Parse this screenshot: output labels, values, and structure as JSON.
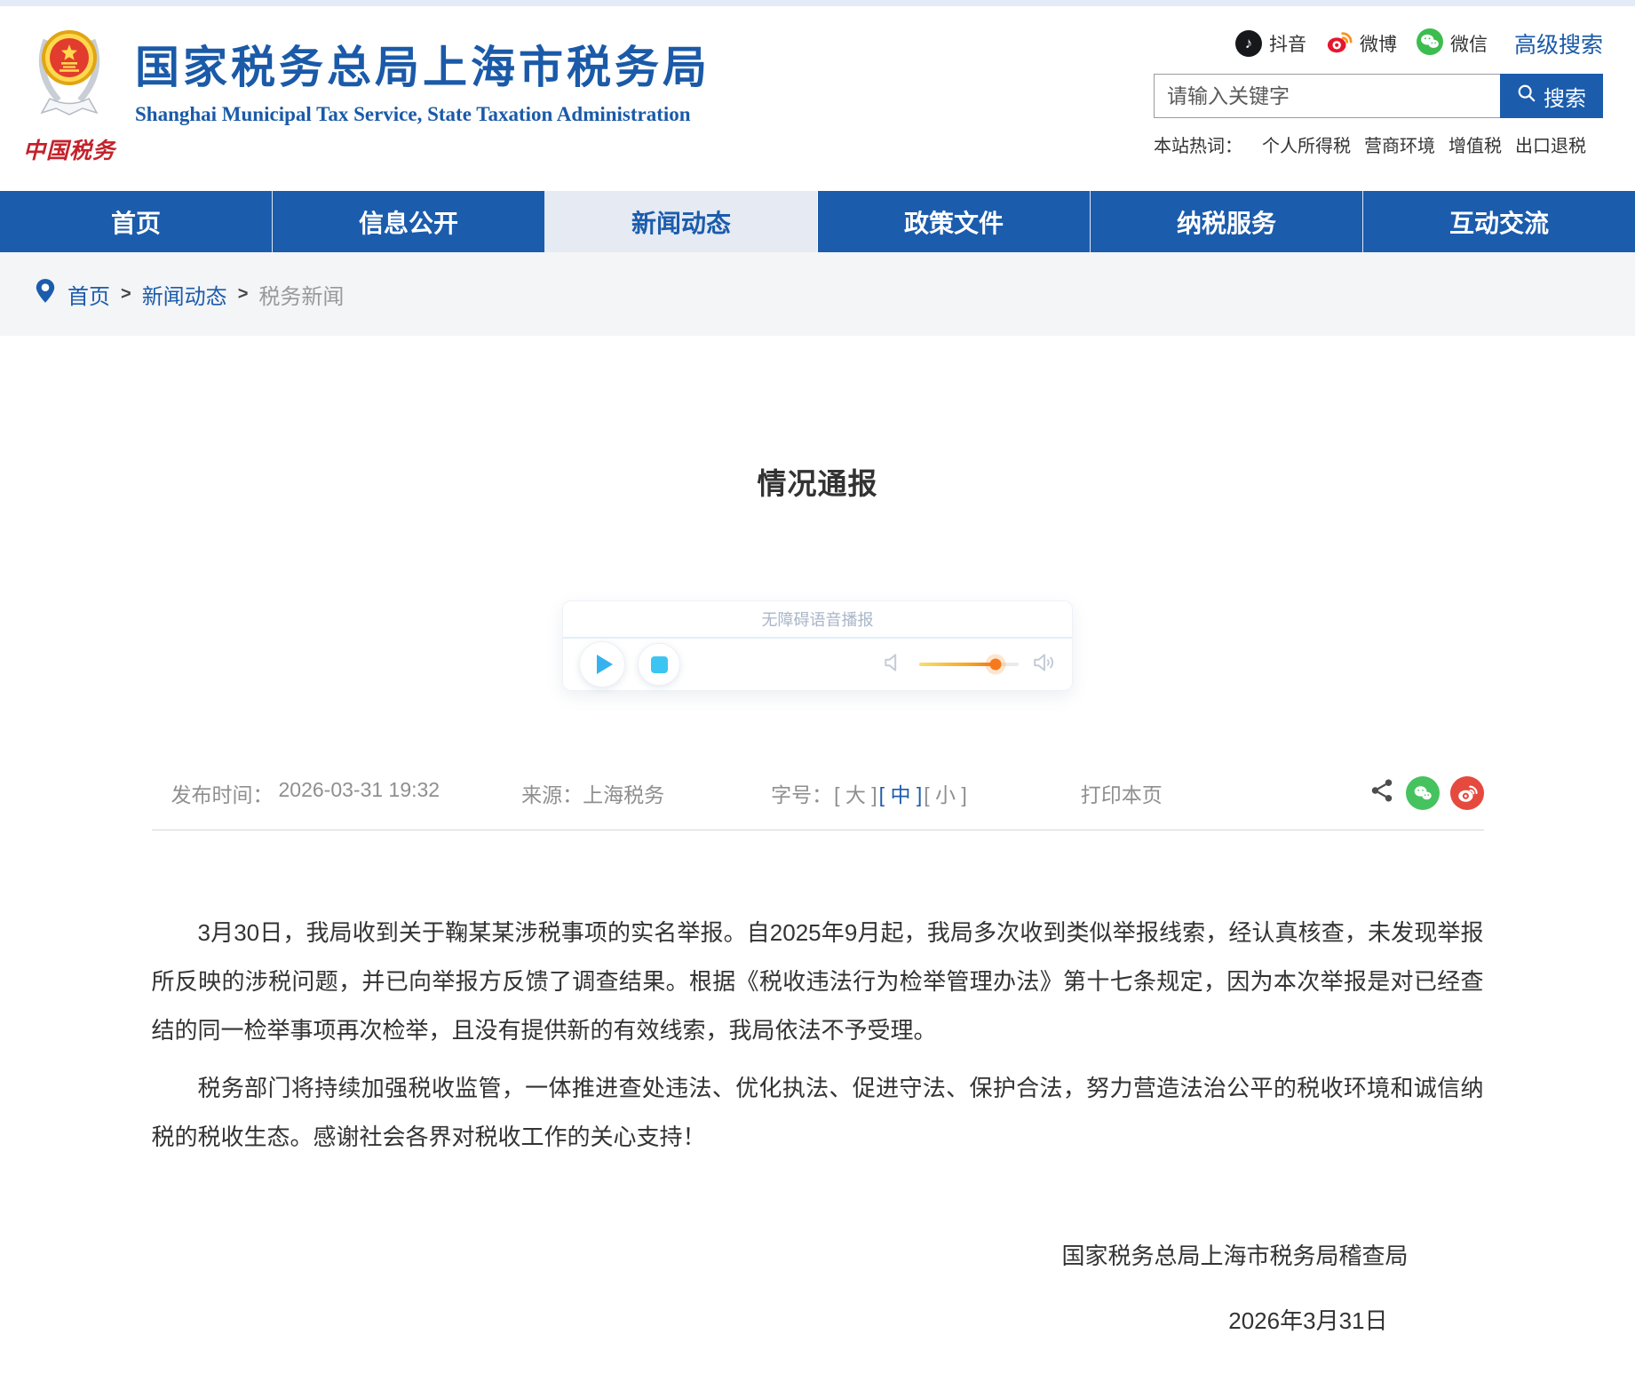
{
  "header": {
    "logo": {
      "caption": "中国税务"
    },
    "site_title": "国家税务总局上海市税务局",
    "site_subtitle": "Shanghai Municipal Tax Service, State Taxation Administration",
    "social": [
      {
        "name": "douyin",
        "label": "抖音"
      },
      {
        "name": "weibo",
        "label": "微博"
      },
      {
        "name": "wechat",
        "label": "微信"
      }
    ],
    "advanced_search_label": "高级搜索",
    "search": {
      "placeholder": "请输入关键字",
      "button_label": "搜索"
    },
    "hotwords": {
      "label": "本站热词：",
      "items": [
        "个人所得税",
        "营商环境",
        "增值税",
        "出口退税"
      ]
    }
  },
  "nav": {
    "items": [
      {
        "label": "首页",
        "active": false
      },
      {
        "label": "信息公开",
        "active": false
      },
      {
        "label": "新闻动态",
        "active": true
      },
      {
        "label": "政策文件",
        "active": false
      },
      {
        "label": "纳税服务",
        "active": false
      },
      {
        "label": "互动交流",
        "active": false
      }
    ]
  },
  "breadcrumb": {
    "separator": ">",
    "items": [
      {
        "label": "首页"
      },
      {
        "label": "新闻动态"
      },
      {
        "label": "税务新闻"
      }
    ]
  },
  "article": {
    "title": "情况通报",
    "audio_player": {
      "title": "无障碍语音播报",
      "volume_percent": 77
    },
    "meta": {
      "publish_label": "发布时间：",
      "publish_time": "2026-03-31 19:32",
      "source_label": "来源：",
      "source": "上海税务",
      "fontsize_label": "字号：",
      "size_options": [
        "[ 大 ]",
        "[ 中 ]",
        "[ 小 ]"
      ],
      "active_size_index": 1,
      "print_label": "打印本页"
    },
    "paragraphs": [
      "3月30日，我局收到关于鞠某某涉税事项的实名举报。自2025年9月起，我局多次收到类似举报线索，经认真核查，未发现举报所反映的涉税问题，并已向举报方反馈了调查结果。根据《税收违法行为检举管理办法》第十七条规定，因为本次举报是对已经查结的同一检举事项再次检举，且没有提供新的有效线索，我局依法不予受理。",
      "税务部门将持续加强税收监管，一体推进查处违法、优化执法、促进守法、保护合法，努力营造法治公平的税收环境和诚信纳税的税收生态。感谢社会各界对税收工作的关心支持！"
    ],
    "signature": "国家税务总局上海市税务局稽查局",
    "date": "2026年3月31日"
  },
  "colors": {
    "primary_blue": "#1b5cad",
    "nav_active_bg": "#e6eaf2",
    "wechat_green": "#46c25f",
    "weibo_red": "#e6493d",
    "douyin_black": "#17181c",
    "slider_orange": "#f57a1e"
  }
}
